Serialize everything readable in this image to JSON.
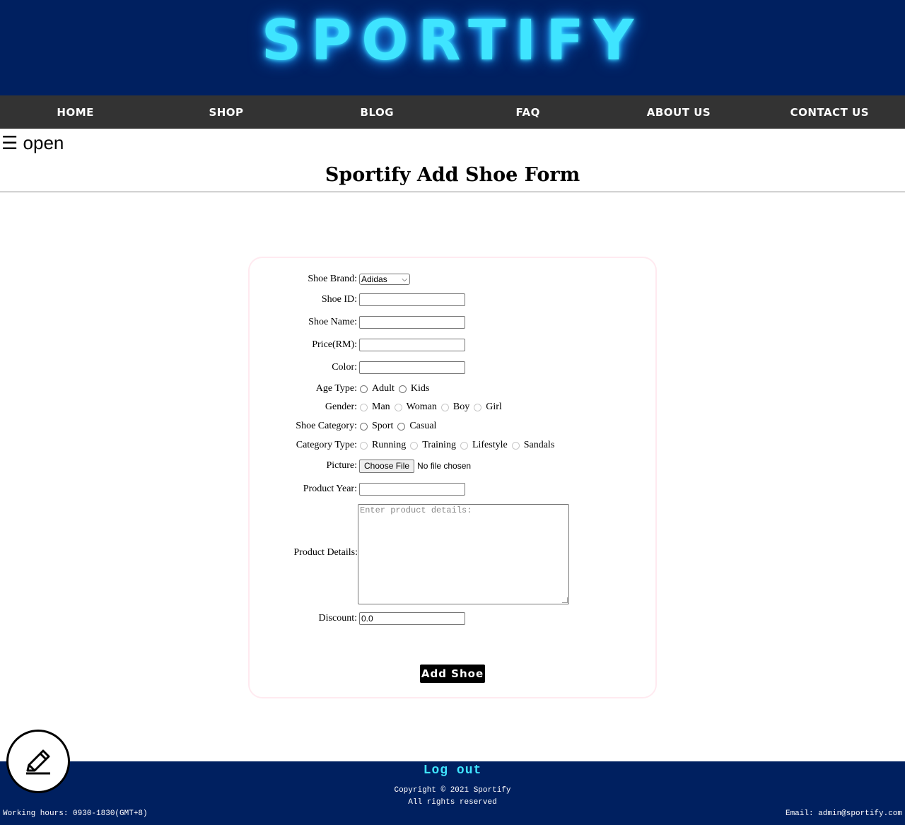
{
  "header": {
    "logo_text": "SPORTIFY"
  },
  "nav": {
    "items": [
      "HOME",
      "SHOP",
      "BLOG",
      "FAQ",
      "ABOUT US",
      "CONTACT US"
    ]
  },
  "sidebar_toggle": {
    "label": "☰ open"
  },
  "page": {
    "title": "Sportify Add Shoe Form"
  },
  "form": {
    "brand": {
      "label": "Shoe Brand:",
      "selected": "Adidas"
    },
    "shoe_id": {
      "label": "Shoe ID:",
      "value": ""
    },
    "shoe_name": {
      "label": "Shoe Name:",
      "value": ""
    },
    "price": {
      "label": "Price(RM):",
      "value": ""
    },
    "color": {
      "label": "Color:",
      "value": ""
    },
    "age_type": {
      "label": "Age Type:",
      "options": [
        "Adult",
        "Kids"
      ]
    },
    "gender": {
      "label": "Gender:",
      "options": [
        "Man",
        "Woman",
        "Boy",
        "Girl"
      ]
    },
    "shoe_category": {
      "label": "Shoe Category:",
      "options": [
        "Sport",
        "Casual"
      ]
    },
    "category_type": {
      "label": "Category Type:",
      "options": [
        "Running",
        "Training",
        "Lifestyle",
        "Sandals"
      ]
    },
    "picture": {
      "label": "Picture:",
      "button": "Choose File",
      "status": "No file chosen"
    },
    "product_year": {
      "label": "Product Year:",
      "value": ""
    },
    "product_details": {
      "label": "Product Details:",
      "placeholder": "Enter product details:"
    },
    "discount": {
      "label": "Discount:",
      "value": "0.0"
    },
    "submit_label": "Add Shoe"
  },
  "footer": {
    "logout": "Log out",
    "copyright_line1": "Copyright © 2021 Sportify",
    "copyright_line2": "All rights reserved",
    "hours": "Working hours: 0930-1830(GMT+8)",
    "email": "Email: admin@sportify.com"
  },
  "icons": {
    "edit": "pencil-icon"
  },
  "colors": {
    "header_bg": "#002060",
    "nav_bg": "#333333",
    "logo_glow": "#3fe4ff"
  }
}
